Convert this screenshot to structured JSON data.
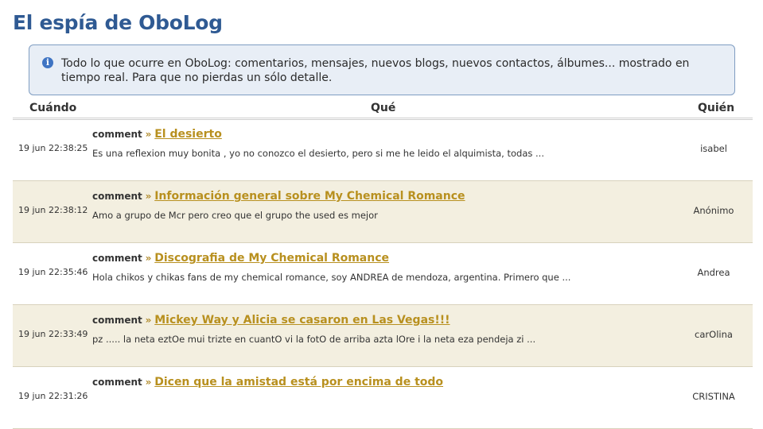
{
  "page": {
    "title": "El espía de OboLog"
  },
  "info": {
    "text": "Todo lo que ocurre en OboLog: comentarios, mensajes, nuevos blogs, nuevos contactos, álbumes... mostrado en tiempo real. Para que no pierdas un sólo detalle.",
    "icon": "info-icon"
  },
  "columns": {
    "when": "Cuándo",
    "what": "Qué",
    "who": "Quién"
  },
  "rows": [
    {
      "time": "19 jun 22:38:25",
      "type": "comment",
      "sep": "»",
      "title": "El desierto",
      "snippet": "Es una reflexion muy bonita , yo no conozco el desierto, pero si me he leido el alquimista, todas ...",
      "author": "isabel"
    },
    {
      "time": "19 jun 22:38:12",
      "type": "comment",
      "sep": "»",
      "title": "Información general sobre My Chemical Romance",
      "snippet": "Amo a grupo de Mcr pero creo que el grupo the used es mejor",
      "author": "Anónimo"
    },
    {
      "time": "19 jun 22:35:46",
      "type": "comment",
      "sep": "»",
      "title": "Discografia de My Chemical Romance",
      "snippet": "Hola chikos y chikas fans de my chemical romance, soy ANDREA de mendoza, argentina. Primero que ...",
      "author": "Andrea"
    },
    {
      "time": "19 jun 22:33:49",
      "type": "comment",
      "sep": "»",
      "title": "Mickey Way y Alicia se casaron en Las Vegas!!!",
      "snippet": "pz ..... la neta eztOe mui trizte en cuantO vi la fotO de arriba azta lOre i la neta eza pendeja zi ...",
      "author": "carOlina"
    },
    {
      "time": "19 jun 22:31:26",
      "type": "comment",
      "sep": "»",
      "title": "Dicen que la amistad está por encima de todo",
      "snippet": "",
      "author": "CRISTINA"
    }
  ],
  "colors": {
    "title": "#2f5a93",
    "link": "#b8901f",
    "alt_row": "#f3efe0",
    "info_bg": "#e8eef6"
  }
}
